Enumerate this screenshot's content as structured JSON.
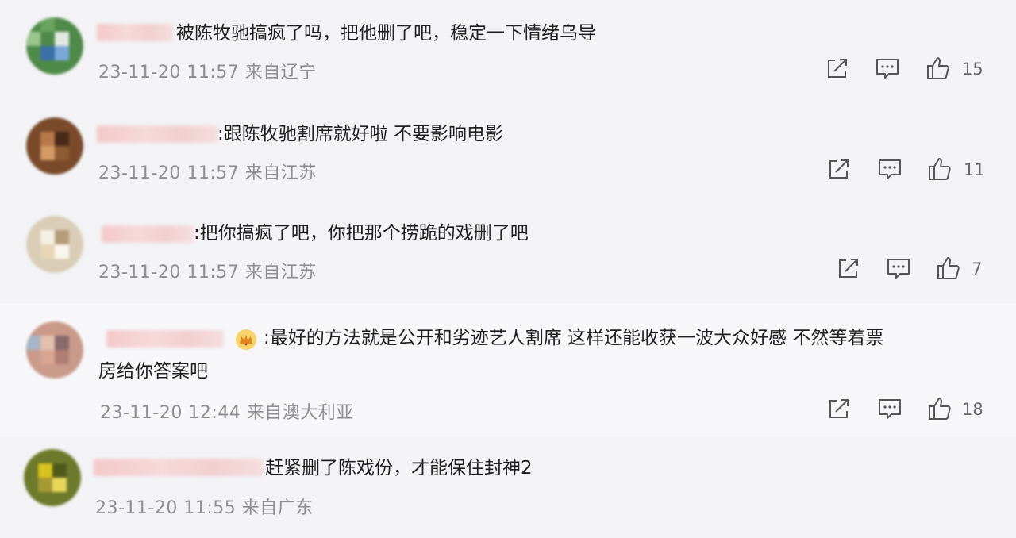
{
  "comments": [
    {
      "text": "被陈牧驰搞疯了吗，把他删了吧，稳定一下情绪乌导",
      "time": "23-11-20 11:57",
      "location": "来自辽宁",
      "likes": "15"
    },
    {
      "text": ":跟陈牧驰割席就好啦 不要影响电影",
      "time": "23-11-20 11:57",
      "location": "来自江苏",
      "likes": "11"
    },
    {
      "text": ":把你搞疯了吧，你把那个捞跪的戏删了吧",
      "time": "23-11-20 11:57",
      "location": "来自江苏",
      "likes": "7"
    },
    {
      "text_line1": ":最好的方法就是公开和劣迹艺人割席  这样还能收获一波大众好感 不然等着票",
      "text_line2": "房给你答案吧",
      "time": "23-11-20 12:44",
      "location": "来自澳大利亚",
      "likes": "18"
    },
    {
      "text": "赶紧删了陈戏份，才能保住封神2",
      "time": "23-11-20 11:55",
      "location": "来自广东"
    }
  ],
  "icons": {
    "share": "share-icon",
    "reply": "comment-icon",
    "like": "thumbs-up-icon",
    "badge": "crown-badge-icon"
  },
  "colors": {
    "text": "#1f1f1f",
    "meta": "#8e8e93",
    "icon": "#555555",
    "crown": "#f2b01e"
  }
}
